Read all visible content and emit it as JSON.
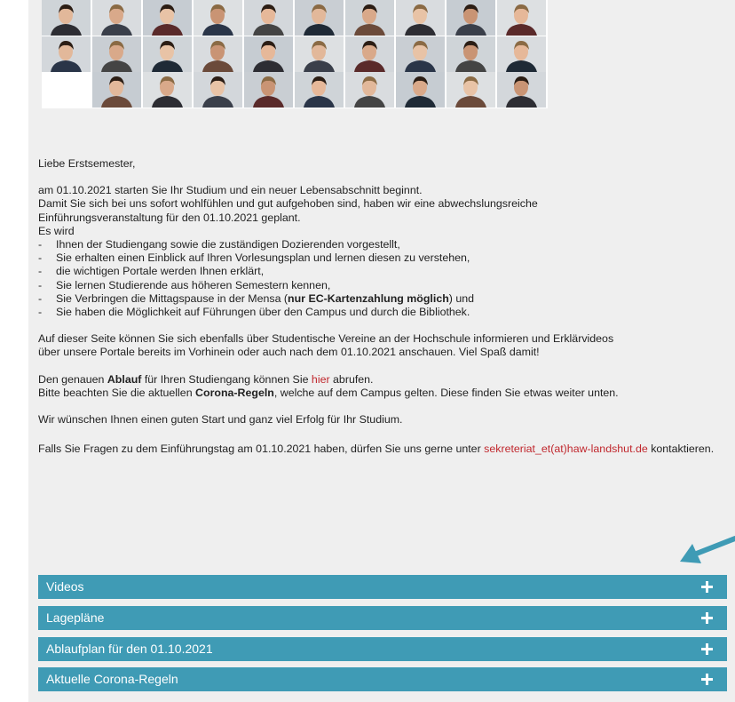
{
  "intro": {
    "greeting": "Liebe Erstsemester,",
    "p1_line1": "am 01.10.2021 starten Sie Ihr Studium und ein neuer Lebensabschnitt beginnt.",
    "p1_line2": "Damit Sie sich bei uns sofort wohlfühlen und gut aufgehoben sind, haben wir eine abwechslungsreiche",
    "p1_line3": "Einführungsveranstaltung für den 01.10.2021 geplant.",
    "p1_line4": "Es wird",
    "list": [
      "Ihnen der Studiengang sowie die zuständigen Dozierenden vorgestellt,",
      "Sie erhalten einen Einblick auf Ihren Vorlesungsplan und lernen diesen zu verstehen,",
      "die wichtigen Portale werden Ihnen erklärt,",
      "Sie lernen Studierende aus höheren Semestern kennen,"
    ],
    "list5_pre": "Sie Verbringen die Mittagspause in der Mensa (",
    "list5_bold": "nur EC-Kartenzahlung möglich",
    "list5_post": ") und",
    "list6": "Sie haben die Möglichkeit auf Führungen über den Campus und durch die Bibliothek.",
    "p2_line1": "Auf dieser Seite können Sie sich ebenfalls über Studentische Vereine an der Hochschule informieren und Erklärvideos",
    "p2_line2": "über unsere Portale bereits im Vorhinein oder auch nach dem 01.10.2021 anschauen. Viel Spaß damit!",
    "p3_pre": "Den genauen ",
    "p3_bold": "Ablauf",
    "p3_mid": " für Ihren Studiengang können Sie ",
    "p3_link": "hier",
    "p3_post": " abrufen.",
    "p4_pre": "Bitte beachten Sie die aktuellen ",
    "p4_bold": "Corona-Regeln",
    "p4_post": ", welche auf dem Campus gelten. Diese finden Sie etwas weiter unten.",
    "p5": "Wir wünschen Ihnen einen guten Start und ganz viel Erfolg für Ihr Studium.",
    "p6_pre": "Falls Sie Fragen zu dem Einführungstag am 01.10.2021 haben, dürfen Sie uns gerne unter ",
    "p6_link": "sekreteriat_et(at)haw-landshut.de",
    "p6_post": " kontaktieren."
  },
  "accordion": [
    {
      "label": "Videos"
    },
    {
      "label": "Lagepläne"
    },
    {
      "label": "Ablaufplan für den 01.10.2021"
    },
    {
      "label": "Aktuelle Corona-Regeln"
    }
  ],
  "colors": {
    "accordion_bg": "#3f9bb5",
    "link": "#c0272d",
    "panel_bg": "#efefef",
    "arrow": "#3f9bb5"
  },
  "icons": {
    "accordion_toggle": "plus-icon",
    "pointer": "arrow-icon"
  }
}
